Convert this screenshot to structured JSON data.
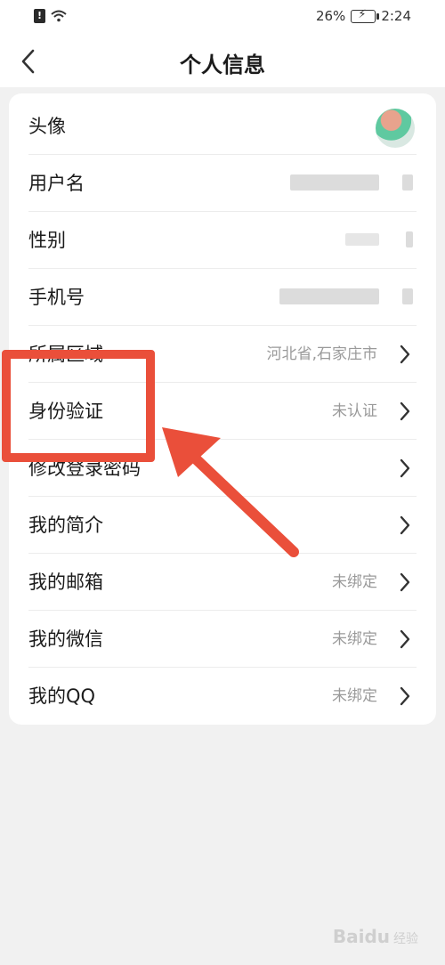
{
  "status_bar": {
    "battery_percent": "26%",
    "time": "2:24"
  },
  "header": {
    "title": "个人信息"
  },
  "rows": [
    {
      "label": "头像",
      "value": "",
      "has_chevron": false
    },
    {
      "label": "用户名",
      "value": "",
      "has_chevron": false
    },
    {
      "label": "性别",
      "value": "",
      "has_chevron": false
    },
    {
      "label": "手机号",
      "value": "",
      "has_chevron": false
    },
    {
      "label": "所属区域",
      "value": "河北省,石家庄市",
      "has_chevron": true
    },
    {
      "label": "身份验证",
      "value": "未认证",
      "has_chevron": true
    },
    {
      "label": "修改登录密码",
      "value": "",
      "has_chevron": true
    },
    {
      "label": "我的简介",
      "value": "",
      "has_chevron": true
    },
    {
      "label": "我的邮箱",
      "value": "未绑定",
      "has_chevron": true
    },
    {
      "label": "我的微信",
      "value": "未绑定",
      "has_chevron": true
    },
    {
      "label": "我的QQ",
      "value": "未绑定",
      "has_chevron": true
    }
  ],
  "annotation": {
    "highlight_color": "#ea4f3a"
  },
  "watermark": {
    "text": "Baidu",
    "sub": "经验"
  },
  "colors": {
    "background": "#f1f1f1",
    "card": "#ffffff",
    "secondary_text": "#9a9a9a",
    "annotation_red": "#ea4f3a"
  }
}
